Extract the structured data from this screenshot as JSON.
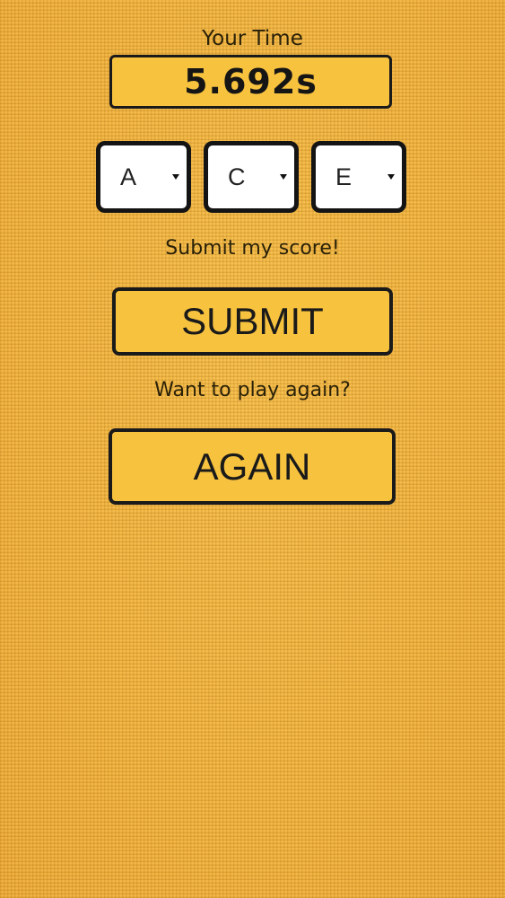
{
  "time": {
    "label": "Your Time",
    "value": "5.692s"
  },
  "initials": [
    {
      "selected": "A"
    },
    {
      "selected": "C"
    },
    {
      "selected": "E"
    }
  ],
  "submit": {
    "prompt": "Submit my score!",
    "button_label": "SUBMIT"
  },
  "again": {
    "prompt": "Want to play again?",
    "button_label": "AGAIN"
  },
  "colors": {
    "background": "#f4b73f",
    "button_fill": "#f7c23e",
    "border": "#1a1a1a"
  }
}
